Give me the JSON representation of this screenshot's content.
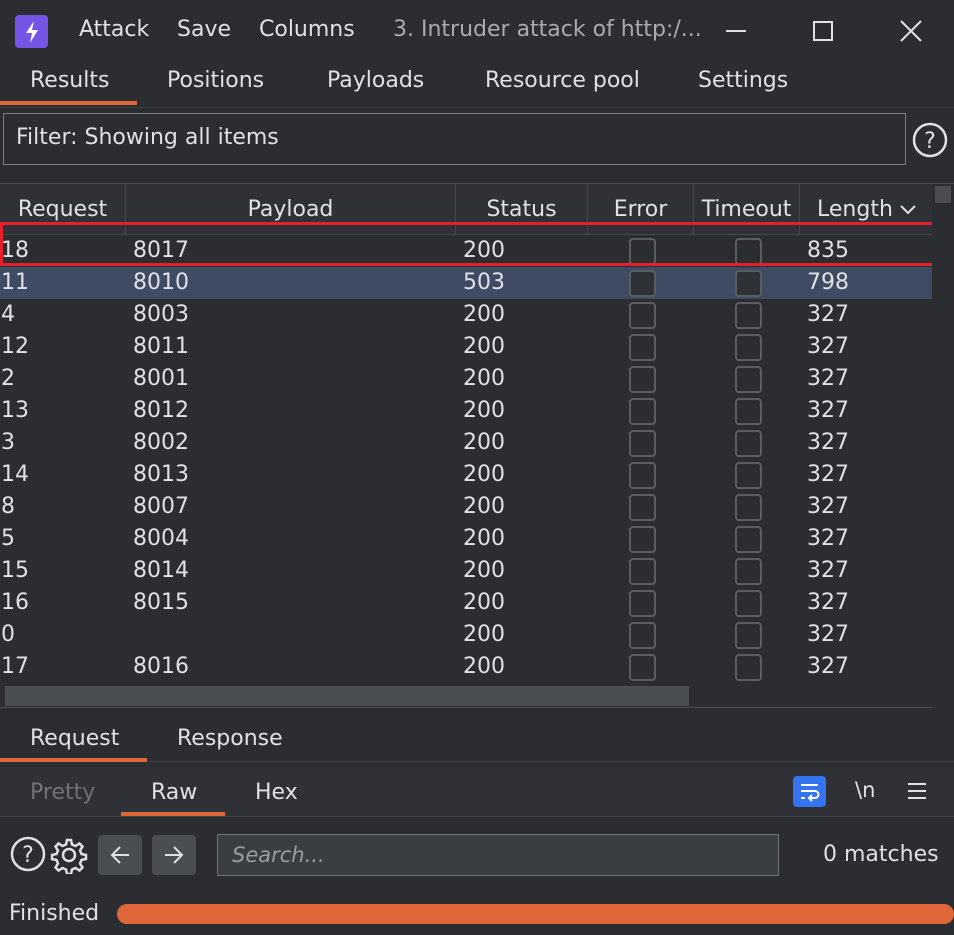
{
  "titlebar": {
    "menu": [
      "Attack",
      "Save",
      "Columns"
    ],
    "title": "3. Intruder attack of http:/..."
  },
  "tabs": [
    "Results",
    "Positions",
    "Payloads",
    "Resource pool",
    "Settings"
  ],
  "filter": {
    "text": "Filter: Showing all items"
  },
  "table": {
    "columns": [
      "Request",
      "Payload",
      "Status",
      "Error",
      "Timeout",
      "Length"
    ],
    "sort_indicator": "chevron-down",
    "rows": [
      {
        "request": "18",
        "payload": "8017",
        "status": "200",
        "length": "835"
      },
      {
        "request": "11",
        "payload": "8010",
        "status": "503",
        "length": "798"
      },
      {
        "request": "4",
        "payload": "8003",
        "status": "200",
        "length": "327"
      },
      {
        "request": "12",
        "payload": "8011",
        "status": "200",
        "length": "327"
      },
      {
        "request": "2",
        "payload": "8001",
        "status": "200",
        "length": "327"
      },
      {
        "request": "13",
        "payload": "8012",
        "status": "200",
        "length": "327"
      },
      {
        "request": "3",
        "payload": "8002",
        "status": "200",
        "length": "327"
      },
      {
        "request": "14",
        "payload": "8013",
        "status": "200",
        "length": "327"
      },
      {
        "request": "8",
        "payload": "8007",
        "status": "200",
        "length": "327"
      },
      {
        "request": "5",
        "payload": "8004",
        "status": "200",
        "length": "327"
      },
      {
        "request": "15",
        "payload": "8014",
        "status": "200",
        "length": "327"
      },
      {
        "request": "16",
        "payload": "8015",
        "status": "200",
        "length": "327"
      },
      {
        "request": "0",
        "payload": "",
        "status": "200",
        "length": "327"
      },
      {
        "request": "17",
        "payload": "8016",
        "status": "200",
        "length": "327"
      }
    ],
    "selected_row": 1,
    "highlighted_row": 0
  },
  "request_tabs": [
    "Request",
    "Response"
  ],
  "view_tabs": [
    "Pretty",
    "Raw",
    "Hex"
  ],
  "view_tools": {
    "newline": "\\n"
  },
  "search": {
    "placeholder": "Search...",
    "matches": "0 matches"
  },
  "status": {
    "text": "Finished",
    "progress": 1.0
  },
  "colors": {
    "accent": "#e0673a",
    "logo": "#7455e6",
    "selection": "#3f4a63",
    "highlight": "#e5202a"
  }
}
